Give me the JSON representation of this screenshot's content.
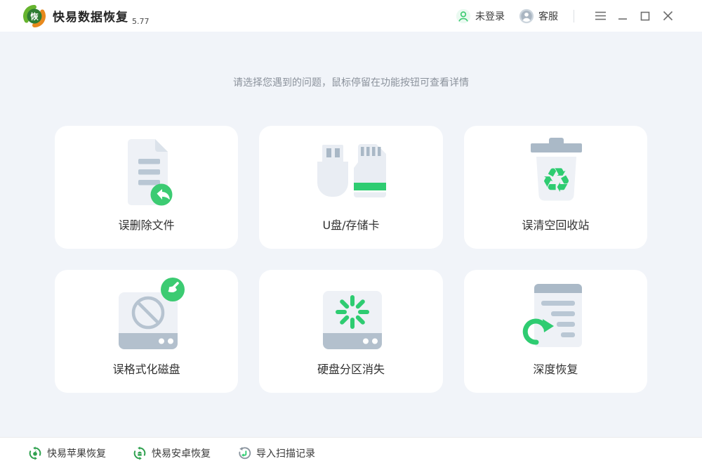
{
  "titlebar": {
    "app_title": "快易数据恢复",
    "version": "5.77",
    "login_label": "未登录",
    "support_label": "客服"
  },
  "main": {
    "hint": "请选择您遇到的问题，鼠标停留在功能按钮可查看详情",
    "cards": [
      {
        "label": "误删除文件",
        "icon": "deleted-file-icon"
      },
      {
        "label": "U盘/存储卡",
        "icon": "usb-sd-card-icon"
      },
      {
        "label": "误清空回收站",
        "icon": "recycle-bin-icon"
      },
      {
        "label": "误格式化磁盘",
        "icon": "formatted-disk-icon"
      },
      {
        "label": "硬盘分区消失",
        "icon": "lost-partition-icon"
      },
      {
        "label": "深度恢复",
        "icon": "deep-recovery-icon"
      }
    ]
  },
  "footer": {
    "apple_recovery_label": "快易苹果恢复",
    "android_recovery_label": "快易安卓恢复",
    "import_scan_label": "导入扫描记录"
  },
  "glyphs": {
    "recycle": "♻",
    "logo_char": "恢"
  },
  "colors": {
    "accent_green": "#2ecc71",
    "badge_green": "#3ccb72",
    "icon_gray_blue": "#aeb9c6",
    "icon_light": "#eef1f6",
    "main_bg": "#f1f4f9",
    "logo_green": "#66b42e",
    "logo_orange": "#e8891d"
  }
}
